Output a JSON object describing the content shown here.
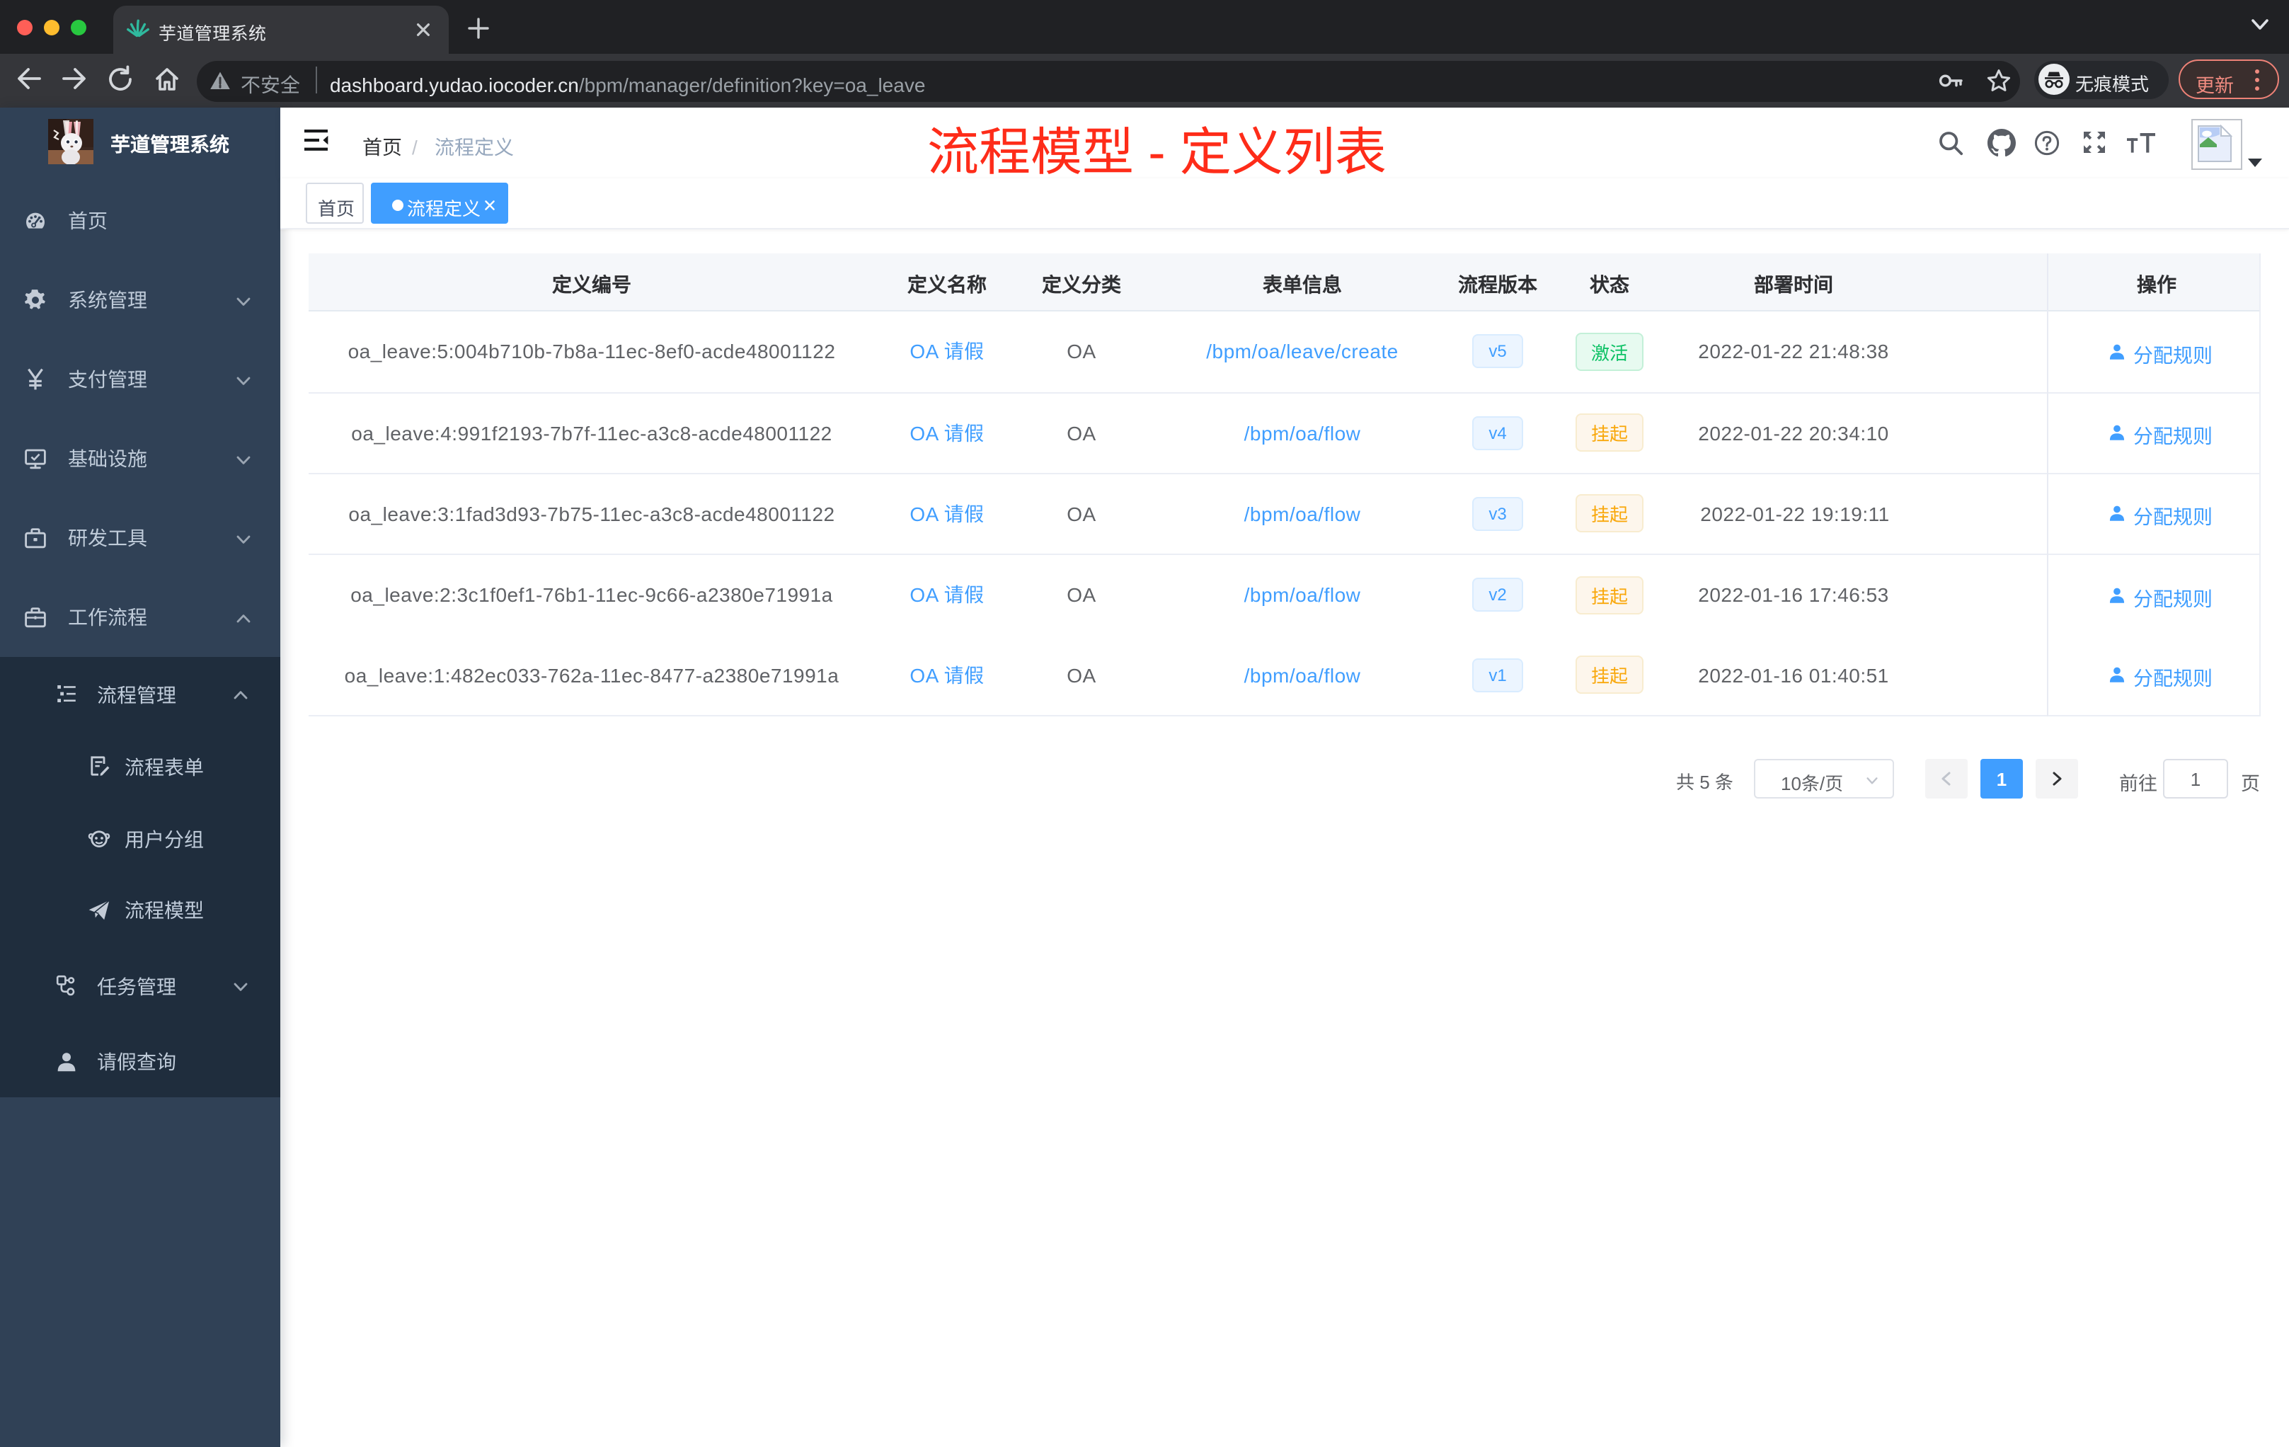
{
  "browser": {
    "tab_title": "芋道管理系统",
    "security_label": "不安全",
    "url_host": "dashboard.yudao.iocoder.cn",
    "url_path": "/bpm/manager/definition?key=oa_leave",
    "incognito_label": "无痕模式",
    "update_label": "更新"
  },
  "sidebar": {
    "logo_title": "芋道管理系统",
    "menu": [
      {
        "label": "首页",
        "icon": "dashboard-icon"
      },
      {
        "label": "系统管理",
        "icon": "gear-icon",
        "arrow": "down"
      },
      {
        "label": "支付管理",
        "icon": "yen-icon",
        "arrow": "down"
      },
      {
        "label": "基础设施",
        "icon": "monitor-icon",
        "arrow": "down"
      },
      {
        "label": "研发工具",
        "icon": "toolbox-icon",
        "arrow": "down"
      },
      {
        "label": "工作流程",
        "icon": "briefcase-icon",
        "arrow": "up"
      }
    ],
    "submenu": [
      {
        "label": "流程管理",
        "icon": "tree-list-icon",
        "arrow": "up",
        "level": 1
      },
      {
        "label": "流程表单",
        "icon": "form-doc-icon",
        "level": 2
      },
      {
        "label": "用户分组",
        "icon": "user-group-icon",
        "level": 2
      },
      {
        "label": "流程模型",
        "icon": "paper-plane-icon",
        "level": 2
      },
      {
        "label": "任务管理",
        "icon": "task-flow-icon",
        "arrow": "down",
        "level": 1
      },
      {
        "label": "请假查询",
        "icon": "person-icon",
        "level": 1
      }
    ]
  },
  "navbar": {
    "breadcrumb_home": "首页",
    "breadcrumb_sep": "/",
    "breadcrumb_current": "流程定义",
    "annotation": "流程模型 - 定义列表"
  },
  "tags": {
    "home": "首页",
    "active": "流程定义"
  },
  "table": {
    "columns": [
      "定义编号",
      "定义名称",
      "定义分类",
      "表单信息",
      "流程版本",
      "状态",
      "部署时间",
      "操作"
    ],
    "action_label": "分配规则",
    "rows": [
      {
        "id": "oa_leave:5:004b710b-7b8a-11ec-8ef0-acde48001122",
        "name": "OA 请假",
        "category": "OA",
        "form": "/bpm/oa/leave/create",
        "version": "v5",
        "status": "激活",
        "status_type": "green",
        "time": "2022-01-22 21:48:38"
      },
      {
        "id": "oa_leave:4:991f2193-7b7f-11ec-a3c8-acde48001122",
        "name": "OA 请假",
        "category": "OA",
        "form": "/bpm/oa/flow",
        "version": "v4",
        "status": "挂起",
        "status_type": "amber",
        "time": "2022-01-22 20:34:10"
      },
      {
        "id": "oa_leave:3:1fad3d93-7b75-11ec-a3c8-acde48001122",
        "name": "OA 请假",
        "category": "OA",
        "form": "/bpm/oa/flow",
        "version": "v3",
        "status": "挂起",
        "status_type": "amber",
        "time": "2022-01-22 19:19:11"
      },
      {
        "id": "oa_leave:2:3c1f0ef1-76b1-11ec-9c66-a2380e71991a",
        "name": "OA 请假",
        "category": "OA",
        "form": "/bpm/oa/flow",
        "version": "v2",
        "status": "挂起",
        "status_type": "amber",
        "time": "2022-01-16 17:46:53"
      },
      {
        "id": "oa_leave:1:482ec033-762a-11ec-8477-a2380e71991a",
        "name": "OA 请假",
        "category": "OA",
        "form": "/bpm/oa/flow",
        "version": "v1",
        "status": "挂起",
        "status_type": "amber",
        "time": "2022-01-16 01:40:51"
      }
    ]
  },
  "pagination": {
    "total": "共 5 条",
    "page_size": "10条/页",
    "current_page": "1",
    "goto_label": "前往",
    "page_unit": "页",
    "goto_value": "1"
  },
  "colors": {
    "accent_blue": "#409eff",
    "success_green": "#11c869",
    "warning_amber": "#f3a73f",
    "sidebar_bg": "#304156",
    "sidebar_sub_bg": "#1f2d3d",
    "annotation_red": "#fe2c19"
  }
}
